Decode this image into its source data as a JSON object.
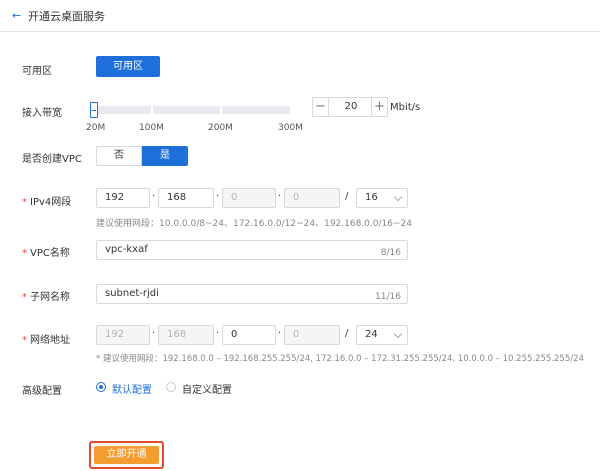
{
  "header": {
    "back_icon": "←",
    "title": "开通云桌面服务"
  },
  "zone": {
    "label": "可用区",
    "button": "可用区"
  },
  "bandwidth": {
    "label": "接入带宽",
    "ticks": [
      "20M",
      "100M",
      "200M",
      "300M"
    ],
    "minus": "−",
    "value": "20",
    "plus": "+",
    "unit": "Mbit/s",
    "level": 0
  },
  "vpc_create": {
    "label": "是否创建VPC",
    "no": "否",
    "yes": "是",
    "selected": "是"
  },
  "ipv4": {
    "label": "IPv4网段",
    "oct1": "192",
    "oct2": "168",
    "oct3": "0",
    "oct4": "0",
    "slash": "/",
    "mask": "16",
    "hint": "建议使用网段：10.0.0.0/8~24、172.16.0.0/12~24、192.168.0.0/16~24"
  },
  "vpc_name": {
    "label": "VPC名称",
    "value": "vpc-kxaf",
    "counter": "8/16"
  },
  "subnet_name": {
    "label": "子网名称",
    "value": "subnet-rjdi",
    "counter": "11/16"
  },
  "network": {
    "label": "网络地址",
    "oct1": "192",
    "oct2": "168",
    "oct3": "0",
    "oct4": "0",
    "slash": "/",
    "mask": "24",
    "hint": "* 建议使用网段：192.168.0.0 – 192.168.255.255/24, 172.16.0.0 – 172.31.255.255/24, 10.0.0.0 – 10.255.255.255/24"
  },
  "advanced": {
    "label": "高级配置",
    "default": "默认配置",
    "custom": "自定义配置",
    "selected": "默认配置"
  },
  "submit": {
    "label": "立即开通"
  },
  "colors": {
    "primary": "#1e6fd9",
    "accent": "#f39c32",
    "highlight": "#e8482c",
    "required": "#e54545"
  }
}
